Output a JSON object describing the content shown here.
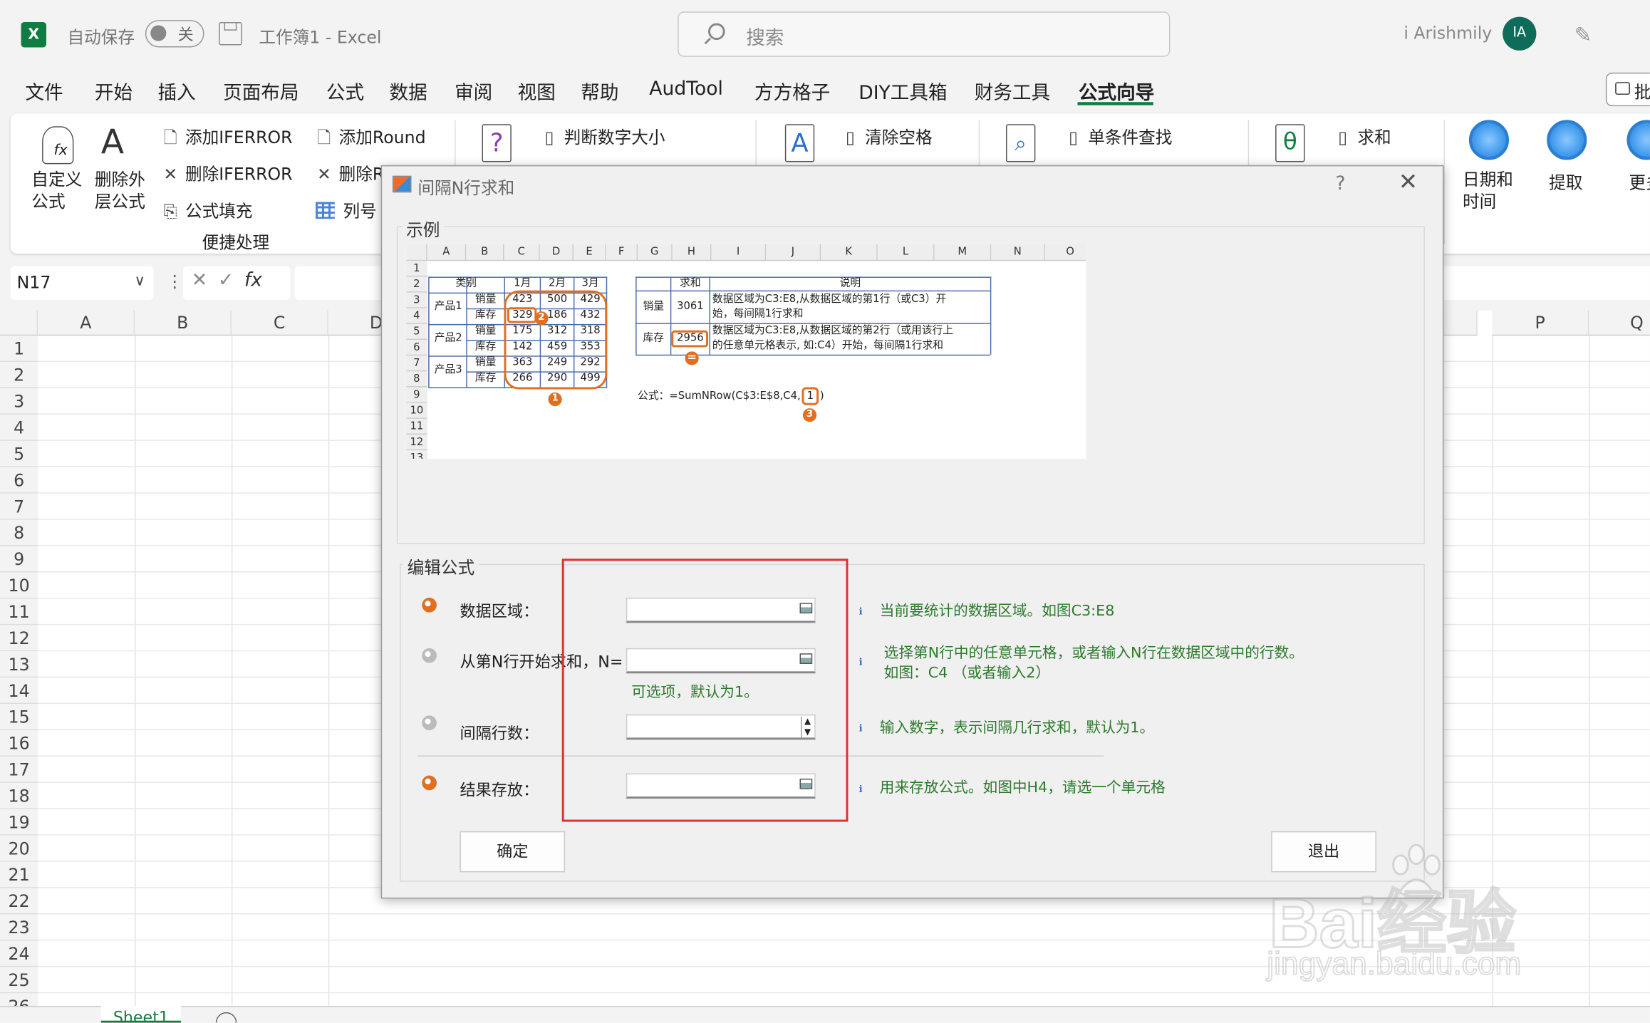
{
  "titlebar": {
    "autosave_label": "自动保存",
    "autosave_state": "关",
    "doc_title": "工作簿1  -  Excel",
    "search_placeholder": "搜索",
    "user_name": "i Arishmily",
    "avatar_initials": "IA"
  },
  "menu": {
    "items": [
      "文件",
      "开始",
      "插入",
      "页面布局",
      "公式",
      "数据",
      "审阅",
      "视图",
      "帮助",
      "AudTool",
      "方方格子",
      "DIY工具箱",
      "财务工具",
      "公式向导"
    ],
    "active": "公式向导",
    "comment_label": "批"
  },
  "ribbon": {
    "custom_formula": "自定义\n公式",
    "remove_outer": "删除外\n层公式",
    "add_iferror": "添加IFERROR",
    "del_iferror": "删除IFERROR",
    "fill_formula": "公式填充",
    "add_round": "添加Round",
    "del_round": "删除R",
    "col_num": "列号",
    "group_label": "便捷处理",
    "judge_size": "判断数字大小",
    "clear_space": "清除空格",
    "single_lookup": "单条件查找",
    "sum": "求和",
    "datetime": "日期和\n时间",
    "extract": "提取",
    "more": "更多"
  },
  "formula_bar": {
    "name_box": "N17",
    "fx": "fx"
  },
  "grid": {
    "columns": [
      "A",
      "B",
      "C",
      "D",
      "P",
      "Q"
    ],
    "rows": [
      "1",
      "2",
      "3",
      "4",
      "5",
      "6",
      "7",
      "8",
      "9",
      "10",
      "11",
      "12",
      "13",
      "14",
      "15",
      "16",
      "17",
      "18",
      "19",
      "20",
      "21",
      "22",
      "23",
      "24",
      "25",
      "26"
    ],
    "sheet_tab": "Sheet1"
  },
  "dialog": {
    "title": "间隔N行求和",
    "example_label": "示例",
    "edit_label": "编辑公式",
    "fields": [
      {
        "label": "数据区域：",
        "hint": "当前要统计的数据区域。如图C3:E8"
      },
      {
        "label": "从第N行开始求和，N=",
        "hint": "选择第N行中的任意单元格，或者输入N行在数据区域中的行数。",
        "hint2": "如图：C4 （或者输入2）",
        "subhint": "可选项，默认为1。"
      },
      {
        "label": "间隔行数：",
        "hint": "输入数字，表示间隔几行求和，默认为1。"
      },
      {
        "label": "结果存放：",
        "hint": "用来存放公式。如图中H4，请选一个单元格"
      }
    ],
    "ok_label": "确定",
    "exit_label": "退出",
    "help": "?",
    "close": "✕"
  },
  "example": {
    "col_headers": [
      "A",
      "B",
      "C",
      "D",
      "E",
      "F",
      "G",
      "H",
      "I",
      "J",
      "K",
      "L",
      "M",
      "N",
      "O"
    ],
    "row_headers": [
      "1",
      "2",
      "3",
      "4",
      "5",
      "6",
      "7",
      "8",
      "9",
      "10",
      "11",
      "12",
      "13"
    ],
    "hdr_category": "类别",
    "months": [
      "1月",
      "2月",
      "3月"
    ],
    "products": [
      "产品1",
      "产品2",
      "产品3"
    ],
    "kinds": [
      "销量",
      "库存"
    ],
    "values": [
      [
        "423",
        "500",
        "429"
      ],
      [
        "329",
        "186",
        "432"
      ],
      [
        "175",
        "312",
        "318"
      ],
      [
        "142",
        "459",
        "353"
      ],
      [
        "363",
        "249",
        "292"
      ],
      [
        "266",
        "290",
        "499"
      ]
    ],
    "sum_hdr": "求和",
    "desc_hdr": "说明",
    "sales_label": "销量",
    "sales_sum": "3061",
    "sales_desc": [
      "数据区域为C3:E8,从数据区域的第1行（或C3）开",
      "始，每间隔1行求和"
    ],
    "stock_label": "库存",
    "stock_sum": "2956",
    "stock_desc": [
      "数据区域为C3:E8,从数据区域的第2行（或用该行上",
      "的任意单元格表示, 如:C4）开始，每间隔1行求和"
    ],
    "formula_prefix": "公式：=SumNRow(C$3:E$8,C4,",
    "formula_arg": "1",
    "formula_suffix": ")",
    "markers": [
      "1",
      "2",
      "3",
      "="
    ]
  },
  "watermark": {
    "brand": "Bai经验",
    "url": "jingyan.baidu.com"
  }
}
